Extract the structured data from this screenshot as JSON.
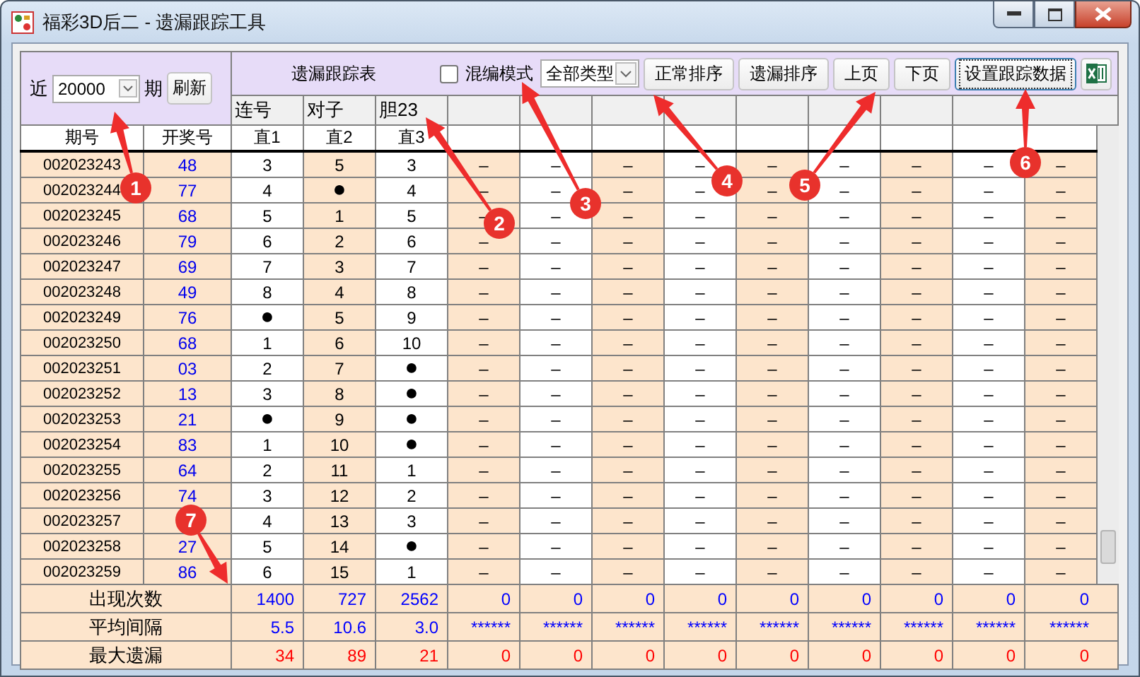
{
  "window": {
    "title": "福彩3D后二 - 遗漏跟踪工具"
  },
  "controls": {
    "range_prefix": "近",
    "range_value": "20000",
    "range_suffix": "期",
    "refresh_button": "刷新",
    "table_title": "遗漏跟踪表",
    "mixed_mode": {
      "label": "混编模式",
      "checked": false
    },
    "type_select": "全部类型",
    "buttons": [
      {
        "label": "正常排序",
        "focused": false
      },
      {
        "label": "遗漏排序",
        "focused": false
      },
      {
        "label": "上页",
        "focused": false
      },
      {
        "label": "下页",
        "focused": false
      },
      {
        "label": "设置跟踪数据",
        "focused": true
      }
    ]
  },
  "table": {
    "group_headers": [
      "连号",
      "对子",
      "胆23"
    ],
    "columns": [
      "期号",
      "开奖号",
      "直1",
      "直2",
      "直3"
    ],
    "rows": [
      {
        "cells": [
          "002023243",
          "48",
          "3",
          "5",
          "3",
          "–",
          "–",
          "–",
          "–",
          "–",
          "–",
          "–",
          "–",
          "–"
        ]
      },
      {
        "cells": [
          "002023244",
          "77",
          "4",
          "●",
          "4",
          "–",
          "–",
          "–",
          "–",
          "–",
          "–",
          "–",
          "–",
          "–"
        ]
      },
      {
        "cells": [
          "002023245",
          "68",
          "5",
          "1",
          "5",
          "–",
          "–",
          "–",
          "–",
          "–",
          "–",
          "–",
          "–",
          "–"
        ]
      },
      {
        "cells": [
          "002023246",
          "79",
          "6",
          "2",
          "6",
          "–",
          "–",
          "–",
          "–",
          "–",
          "–",
          "–",
          "–",
          "–"
        ]
      },
      {
        "cells": [
          "002023247",
          "69",
          "7",
          "3",
          "7",
          "–",
          "–",
          "–",
          "–",
          "–",
          "–",
          "–",
          "–",
          "–"
        ]
      },
      {
        "cells": [
          "002023248",
          "49",
          "8",
          "4",
          "8",
          "–",
          "–",
          "–",
          "–",
          "–",
          "–",
          "–",
          "–",
          "–"
        ]
      },
      {
        "cells": [
          "002023249",
          "76",
          "●",
          "5",
          "9",
          "–",
          "–",
          "–",
          "–",
          "–",
          "–",
          "–",
          "–",
          "–"
        ]
      },
      {
        "cells": [
          "002023250",
          "68",
          "1",
          "6",
          "10",
          "–",
          "–",
          "–",
          "–",
          "–",
          "–",
          "–",
          "–",
          "–"
        ]
      },
      {
        "cells": [
          "002023251",
          "03",
          "2",
          "7",
          "●",
          "–",
          "–",
          "–",
          "–",
          "–",
          "–",
          "–",
          "–",
          "–"
        ]
      },
      {
        "cells": [
          "002023252",
          "13",
          "3",
          "8",
          "●",
          "–",
          "–",
          "–",
          "–",
          "–",
          "–",
          "–",
          "–",
          "–"
        ]
      },
      {
        "cells": [
          "002023253",
          "21",
          "●",
          "9",
          "●",
          "–",
          "–",
          "–",
          "–",
          "–",
          "–",
          "–",
          "–",
          "–"
        ]
      },
      {
        "cells": [
          "002023254",
          "83",
          "1",
          "10",
          "●",
          "–",
          "–",
          "–",
          "–",
          "–",
          "–",
          "–",
          "–",
          "–"
        ]
      },
      {
        "cells": [
          "002023255",
          "64",
          "2",
          "11",
          "1",
          "–",
          "–",
          "–",
          "–",
          "–",
          "–",
          "–",
          "–",
          "–"
        ]
      },
      {
        "cells": [
          "002023256",
          "74",
          "3",
          "12",
          "2",
          "–",
          "–",
          "–",
          "–",
          "–",
          "–",
          "–",
          "–",
          "–"
        ]
      },
      {
        "cells": [
          "002023257",
          "",
          "4",
          "13",
          "3",
          "–",
          "–",
          "–",
          "–",
          "–",
          "–",
          "–",
          "–",
          "–"
        ]
      },
      {
        "cells": [
          "002023258",
          "27",
          "5",
          "14",
          "●",
          "–",
          "–",
          "–",
          "–",
          "–",
          "–",
          "–",
          "–",
          "–"
        ]
      },
      {
        "cells": [
          "002023259",
          "86",
          "6",
          "15",
          "1",
          "–",
          "–",
          "–",
          "–",
          "–",
          "–",
          "–",
          "–",
          "–"
        ]
      }
    ],
    "footer": [
      {
        "label": "出现次数",
        "color": "#0000ff",
        "values": [
          "1400",
          "727",
          "2562",
          "0",
          "0",
          "0",
          "0",
          "0",
          "0",
          "0",
          "0",
          "0"
        ]
      },
      {
        "label": "平均间隔",
        "color": "#0000ff",
        "values": [
          "5.5",
          "10.6",
          "3.0",
          "******",
          "******",
          "******",
          "******",
          "******",
          "******",
          "******",
          "******",
          "******"
        ]
      },
      {
        "label": "最大遗漏",
        "color": "#ff0000",
        "values": [
          "34",
          "89",
          "21",
          "0",
          "0",
          "0",
          "0",
          "0",
          "0",
          "0",
          "0",
          "0"
        ]
      }
    ]
  },
  "annotations": [
    {
      "number": "1"
    },
    {
      "number": "2"
    },
    {
      "number": "3"
    },
    {
      "number": "4"
    },
    {
      "number": "5"
    },
    {
      "number": "6"
    },
    {
      "number": "7"
    }
  ]
}
